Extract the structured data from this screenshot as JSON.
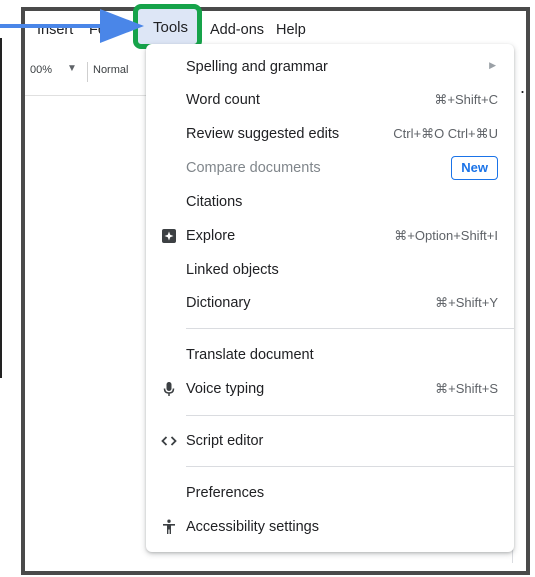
{
  "menubar": {
    "items": [
      "Insert",
      "Fo",
      "Tools",
      "Add-ons",
      "Help"
    ]
  },
  "toolbar": {
    "zoom": "00%",
    "paragraph_style": "Normal"
  },
  "tools_menu": {
    "items": [
      {
        "label": "Spelling and grammar",
        "has_submenu": true
      },
      {
        "label": "Word count",
        "shortcut": "⌘+Shift+C"
      },
      {
        "label": "Review suggested edits",
        "shortcut": "Ctrl+⌘O Ctrl+⌘U"
      },
      {
        "label": "Compare documents",
        "badge": "New",
        "disabled": true
      },
      {
        "label": "Citations"
      },
      {
        "label": "Explore",
        "shortcut": "⌘+Option+Shift+I",
        "icon": "explore-icon"
      },
      {
        "label": "Linked objects"
      },
      {
        "label": "Dictionary",
        "shortcut": "⌘+Shift+Y"
      },
      {
        "label": "Translate document"
      },
      {
        "label": "Voice typing",
        "shortcut": "⌘+Shift+S",
        "icon": "microphone-icon"
      },
      {
        "label": "Script editor",
        "icon": "code-icon"
      },
      {
        "label": "Preferences"
      },
      {
        "label": "Accessibility settings",
        "icon": "accessibility-icon"
      }
    ]
  },
  "colors": {
    "highlight_border": "#16a34a",
    "arrow": "#4a86e8",
    "badge": "#1a73e8",
    "frame": "#4a4a4a"
  }
}
